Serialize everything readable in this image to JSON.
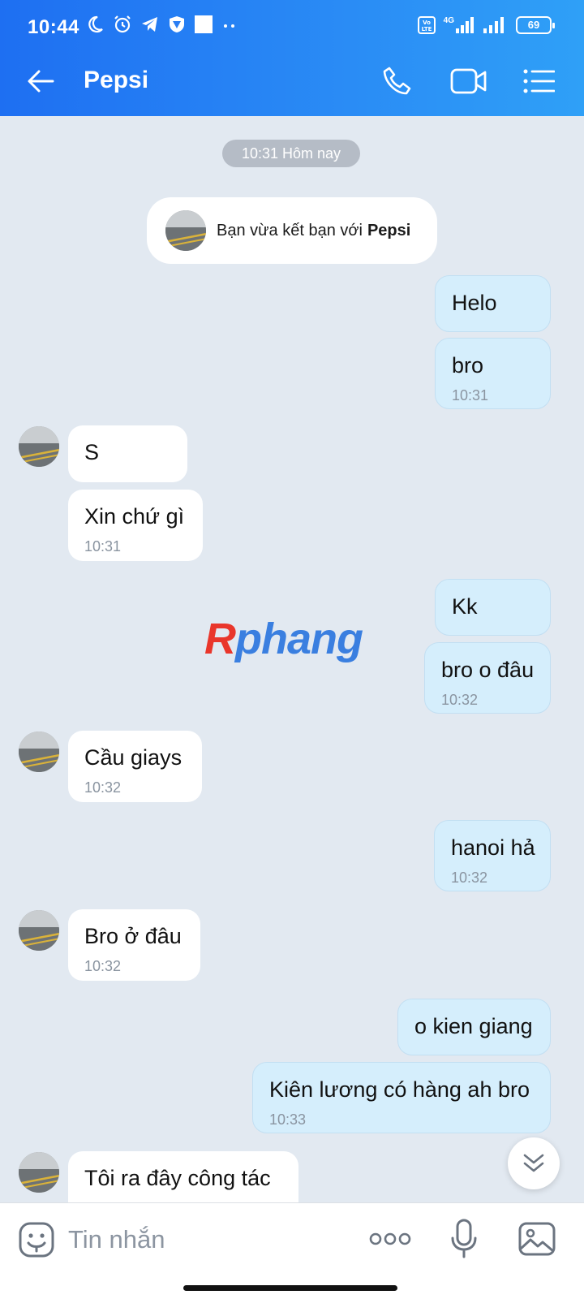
{
  "status_bar": {
    "time": "10:44",
    "network": "4G",
    "volte": "Vo LTE",
    "battery": "69"
  },
  "header": {
    "title": "Pepsi"
  },
  "chat": {
    "date_pill": "10:31 Hôm nay",
    "system_message": {
      "text": "Bạn vừa kết bạn với",
      "name": "Pepsi"
    },
    "messages": [
      {
        "side": "sent",
        "text": "Helo",
        "time": ""
      },
      {
        "side": "sent",
        "text": "bro",
        "time": "10:31"
      },
      {
        "side": "recv",
        "text": "S",
        "time": ""
      },
      {
        "side": "recv",
        "text": "Xin chứ gì",
        "time": "10:31"
      },
      {
        "side": "sent",
        "text": "Kk",
        "time": ""
      },
      {
        "side": "sent",
        "text": "bro o đâu",
        "time": "10:32"
      },
      {
        "side": "recv",
        "text": "Cầu giays",
        "time": "10:32"
      },
      {
        "side": "sent",
        "text": "hanoi hả",
        "time": "10:32"
      },
      {
        "side": "recv",
        "text": "Bro ở đâu",
        "time": "10:32"
      },
      {
        "side": "sent",
        "text": "o kien giang",
        "time": ""
      },
      {
        "side": "sent",
        "text": "Kiên lương có hàng ah bro",
        "time": "10:33"
      },
      {
        "side": "recv",
        "text": "Tôi ra đây công tác",
        "time": ""
      }
    ]
  },
  "watermark": {
    "first_letter": "R",
    "rest": "phang"
  },
  "composer": {
    "placeholder": "Tin nhắn"
  },
  "colors": {
    "header_blue": "#1e6ff2",
    "sent_bubble": "#d5eefc",
    "background": "#e2e9f1"
  }
}
